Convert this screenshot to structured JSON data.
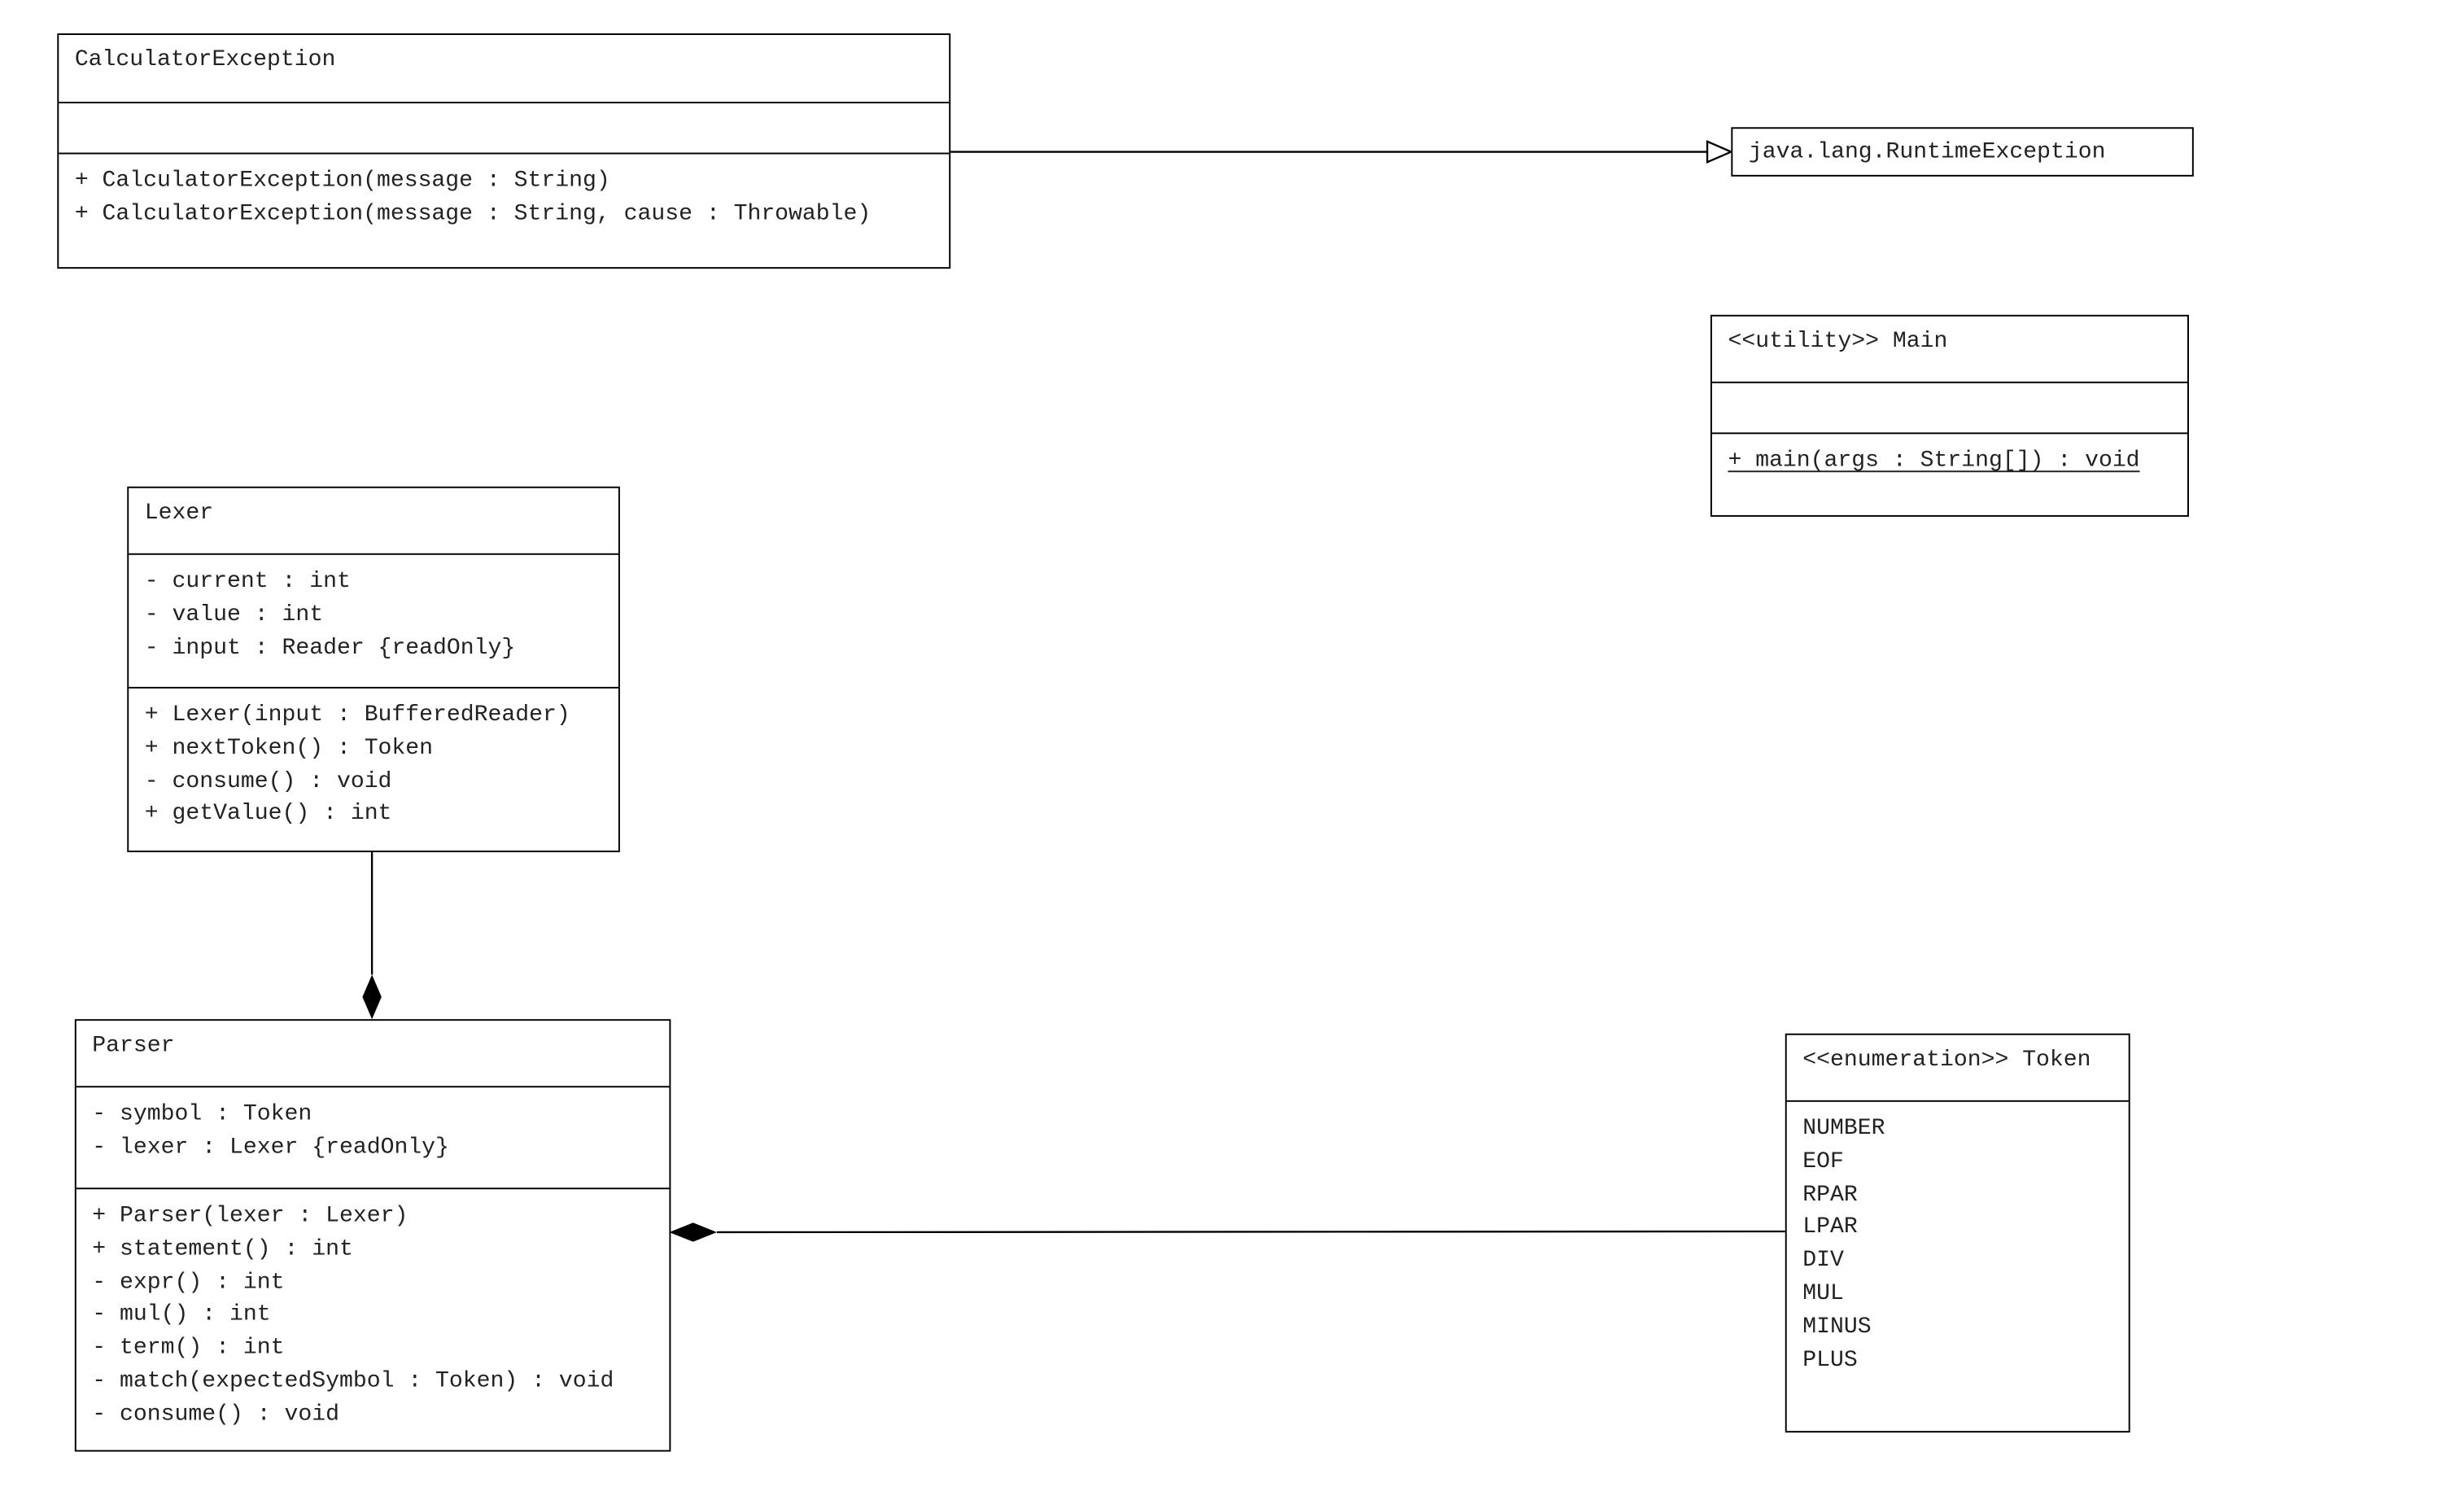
{
  "classes": [
    {
      "id": "calculator-exception",
      "name": "CalculatorException",
      "attributes": [],
      "methods": [
        {
          "text": "+ CalculatorException(message : String)"
        },
        {
          "text": "+ CalculatorException(message : String, cause : Throwable)"
        }
      ]
    },
    {
      "id": "runtime-exception",
      "name": "java.lang.RuntimeException",
      "attributes": null,
      "methods": null
    },
    {
      "id": "main",
      "name": "<<utility>> Main",
      "attributes": [],
      "methods": [
        {
          "text": "+ main(args : String[]) : void",
          "static": true
        }
      ]
    },
    {
      "id": "lexer",
      "name": "Lexer",
      "attributes": [
        {
          "text": "- current : int"
        },
        {
          "text": "- value : int"
        },
        {
          "text": "- input : Reader {readOnly}"
        }
      ],
      "methods": [
        {
          "text": "+ Lexer(input : BufferedReader)"
        },
        {
          "text": "+ nextToken() : Token"
        },
        {
          "text": "- consume() : void"
        },
        {
          "text": "+ getValue() : int"
        }
      ]
    },
    {
      "id": "parser",
      "name": "Parser",
      "attributes": [
        {
          "text": "- symbol : Token"
        },
        {
          "text": "- lexer : Lexer {readOnly}"
        }
      ],
      "methods": [
        {
          "text": "+ Parser(lexer : Lexer)"
        },
        {
          "text": "+ statement() : int"
        },
        {
          "text": "- expr() : int"
        },
        {
          "text": "- mul() : int"
        },
        {
          "text": "- term() : int"
        },
        {
          "text": "- match(expectedSymbol : Token) : void"
        },
        {
          "text": "- consume() : void"
        }
      ]
    },
    {
      "id": "token",
      "name": "<<enumeration>> Token",
      "attributes": [
        {
          "text": "NUMBER"
        },
        {
          "text": "EOF"
        },
        {
          "text": "RPAR"
        },
        {
          "text": "LPAR"
        },
        {
          "text": "DIV"
        },
        {
          "text": "MUL"
        },
        {
          "text": "MINUS"
        },
        {
          "text": "PLUS"
        }
      ],
      "methods": null
    }
  ],
  "relations": [
    {
      "type": "generalization",
      "from": "calculator-exception",
      "to": "runtime-exception"
    },
    {
      "type": "composition",
      "from": "lexer",
      "to": "parser"
    },
    {
      "type": "composition",
      "from": "token",
      "to": "parser"
    }
  ]
}
